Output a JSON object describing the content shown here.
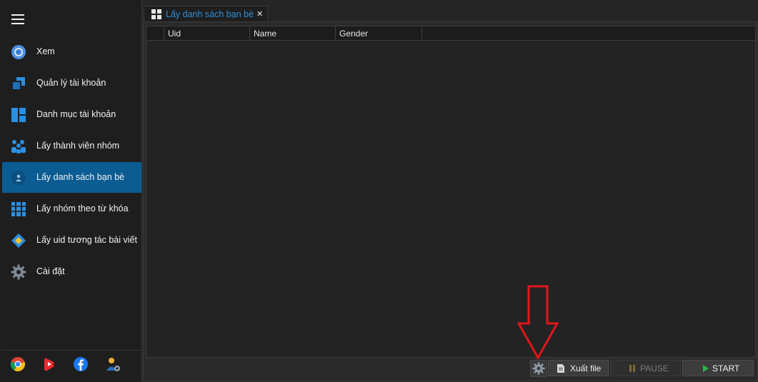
{
  "sidebar": {
    "items": [
      {
        "label": "Xem",
        "icon": "chrome-icon"
      },
      {
        "label": "Quản lý tài khoản",
        "icon": "accounts-icon"
      },
      {
        "label": "Danh mục tài khoản",
        "icon": "dashboard-icon"
      },
      {
        "label": "Lấy thành viên nhóm",
        "icon": "group-members-icon"
      },
      {
        "label": "Lấy danh sách bạn bè",
        "icon": "friends-icon",
        "active": true
      },
      {
        "label": "Lấy nhóm theo từ khóa",
        "icon": "keyword-groups-icon"
      },
      {
        "label": "Lấy uid tương tác bài viết",
        "icon": "post-interaction-icon"
      },
      {
        "label": "Cài đặt",
        "icon": "gear-icon"
      }
    ],
    "bottom_icons": [
      "chrome-icon",
      "youtube-shorts-icon",
      "facebook-icon",
      "user-settings-icon"
    ]
  },
  "tab": {
    "label": "Lấy danh sách bạn bè",
    "close": "✕"
  },
  "grid": {
    "columns": [
      "Uid",
      "Name",
      "Gender"
    ],
    "rows": []
  },
  "toolbar": {
    "export_label": "Xuất file",
    "pause_label": "PAUSE",
    "start_label": "START"
  },
  "colors": {
    "accent": "#0b5c93",
    "tab_text": "#2f8fd6",
    "arrow": "#e0161b",
    "start_play": "#2fb54a"
  }
}
